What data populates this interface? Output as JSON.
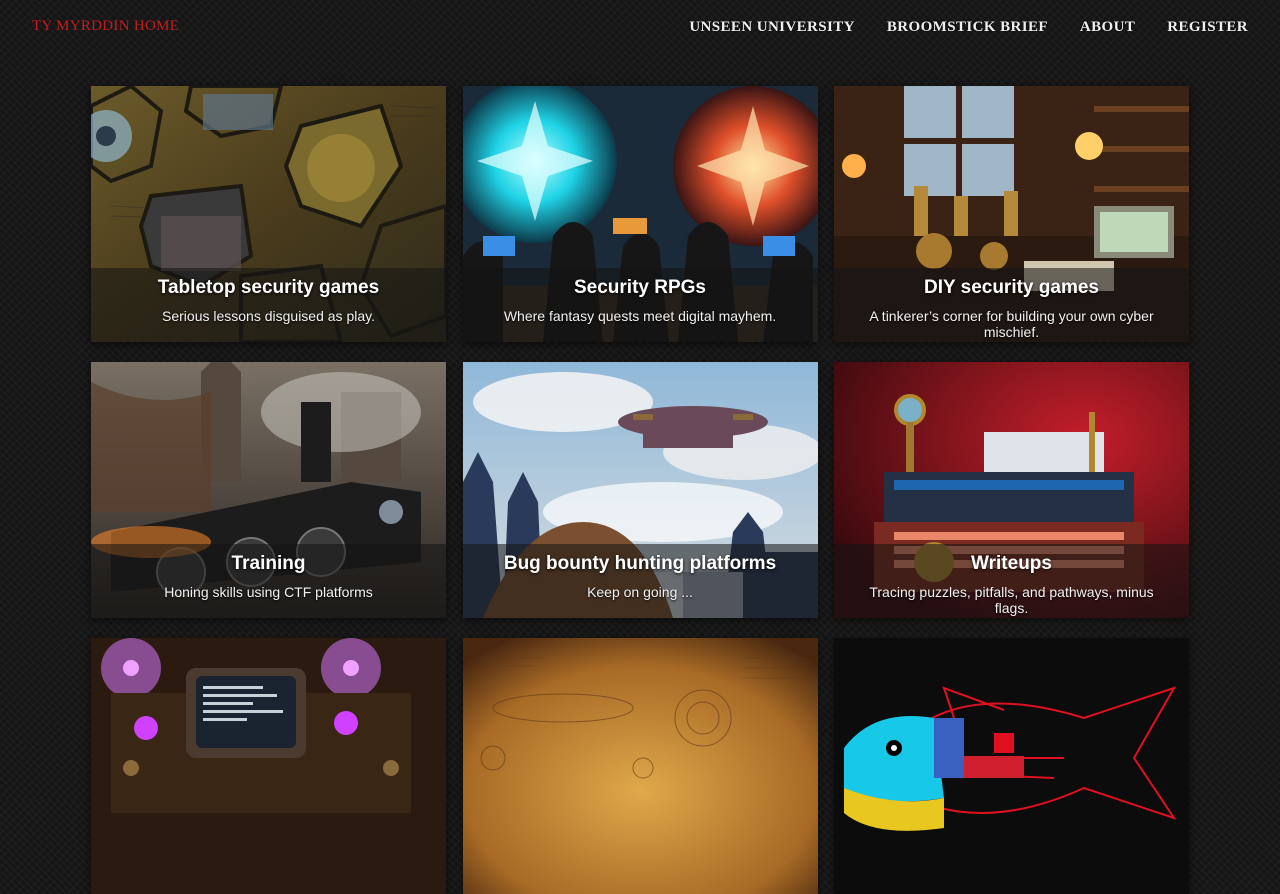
{
  "header": {
    "brand": "TY MYRDDIN HOME",
    "nav": [
      {
        "label": "UNSEEN UNIVERSITY"
      },
      {
        "label": "BROOMSTICK BRIEF"
      },
      {
        "label": "ABOUT"
      },
      {
        "label": "REGISTER"
      }
    ]
  },
  "cards": [
    {
      "title": "Tabletop security games",
      "subtitle": "Serious lessons disguised as play."
    },
    {
      "title": "Security RPGs",
      "subtitle": "Where fantasy quests meet digital mayhem."
    },
    {
      "title": "DIY security games",
      "subtitle": "A tinkerer’s corner for building your own cyber mischief."
    },
    {
      "title": "Training",
      "subtitle": "Honing skills using CTF platforms"
    },
    {
      "title": "Bug bounty hunting platforms",
      "subtitle": "Keep on going ..."
    },
    {
      "title": "Writeups",
      "subtitle": "Tracing puzzles, pitfalls, and pathways, minus flags."
    },
    {
      "title": "",
      "subtitle": ""
    },
    {
      "title": "",
      "subtitle": ""
    },
    {
      "title": "",
      "subtitle": ""
    }
  ],
  "colors": {
    "brand": "#c21e1e",
    "nav_text": "#f0f0f0",
    "page_bg": "#151515"
  }
}
